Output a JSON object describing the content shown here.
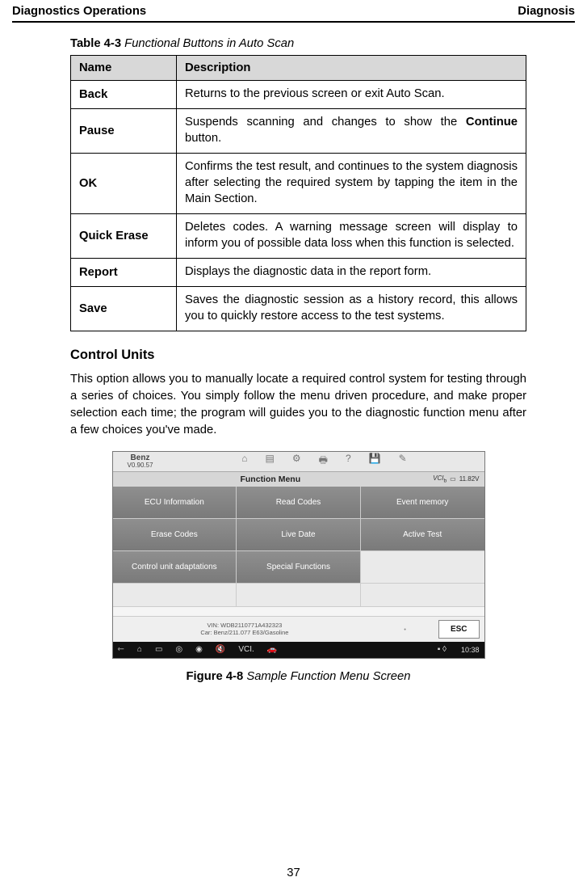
{
  "header": {
    "left": "Diagnostics Operations",
    "right": "Diagnosis"
  },
  "table": {
    "caption_bold": "Table 4-3",
    "caption_italic": " Functional Buttons in Auto Scan",
    "head": {
      "name": "Name",
      "desc": "Description"
    },
    "rows": [
      {
        "name": "Back",
        "desc": "Returns to the previous screen or exit Auto Scan."
      },
      {
        "name": "Pause",
        "desc_pre": "Suspends scanning and changes to show the ",
        "desc_bold": "Continue",
        "desc_post": " button."
      },
      {
        "name": "OK",
        "desc": "Confirms the test result, and continues to the system diagnosis after selecting the required system by tapping the item in the Main Section."
      },
      {
        "name": "Quick Erase",
        "desc": "Deletes codes. A warning message screen will display to inform you of possible data loss when this function is selected."
      },
      {
        "name": "Report",
        "desc": "Displays the diagnostic data in the report form."
      },
      {
        "name": "Save",
        "desc": "Saves the diagnostic session as a history record, this allows you to quickly restore access to the test systems."
      }
    ]
  },
  "section": {
    "heading": "Control Units",
    "paragraph": "This option allows you to manually locate a required control system for testing through a series of choices. You simply follow the menu driven procedure, and make proper selection each time; the program will guides you to the diagnostic function menu after a few choices you've made."
  },
  "device": {
    "brand_name": "Benz",
    "brand_ver": "V0.90.57",
    "title": "Function Menu",
    "vci": "VCI",
    "voltage": "11.82V",
    "cells": {
      "r0c0": "ECU Information",
      "r0c1": "Read Codes",
      "r0c2": "Event memory",
      "r1c0": "Erase Codes",
      "r1c1": "Live Date",
      "r1c2": "Active Test",
      "r2c0": "Control unit adaptations",
      "r2c1": "Special Functions",
      "r2c2": ""
    },
    "vin_line1": "VIN: WDB2110771A432323",
    "vin_line2": "Car: Benz/211.077 E63/Gasoline",
    "esc": "ESC",
    "time": "10:38"
  },
  "figure": {
    "caption_bold": "Figure 4-8",
    "caption_italic": " Sample Function Menu Screen"
  },
  "page_number": "37"
}
